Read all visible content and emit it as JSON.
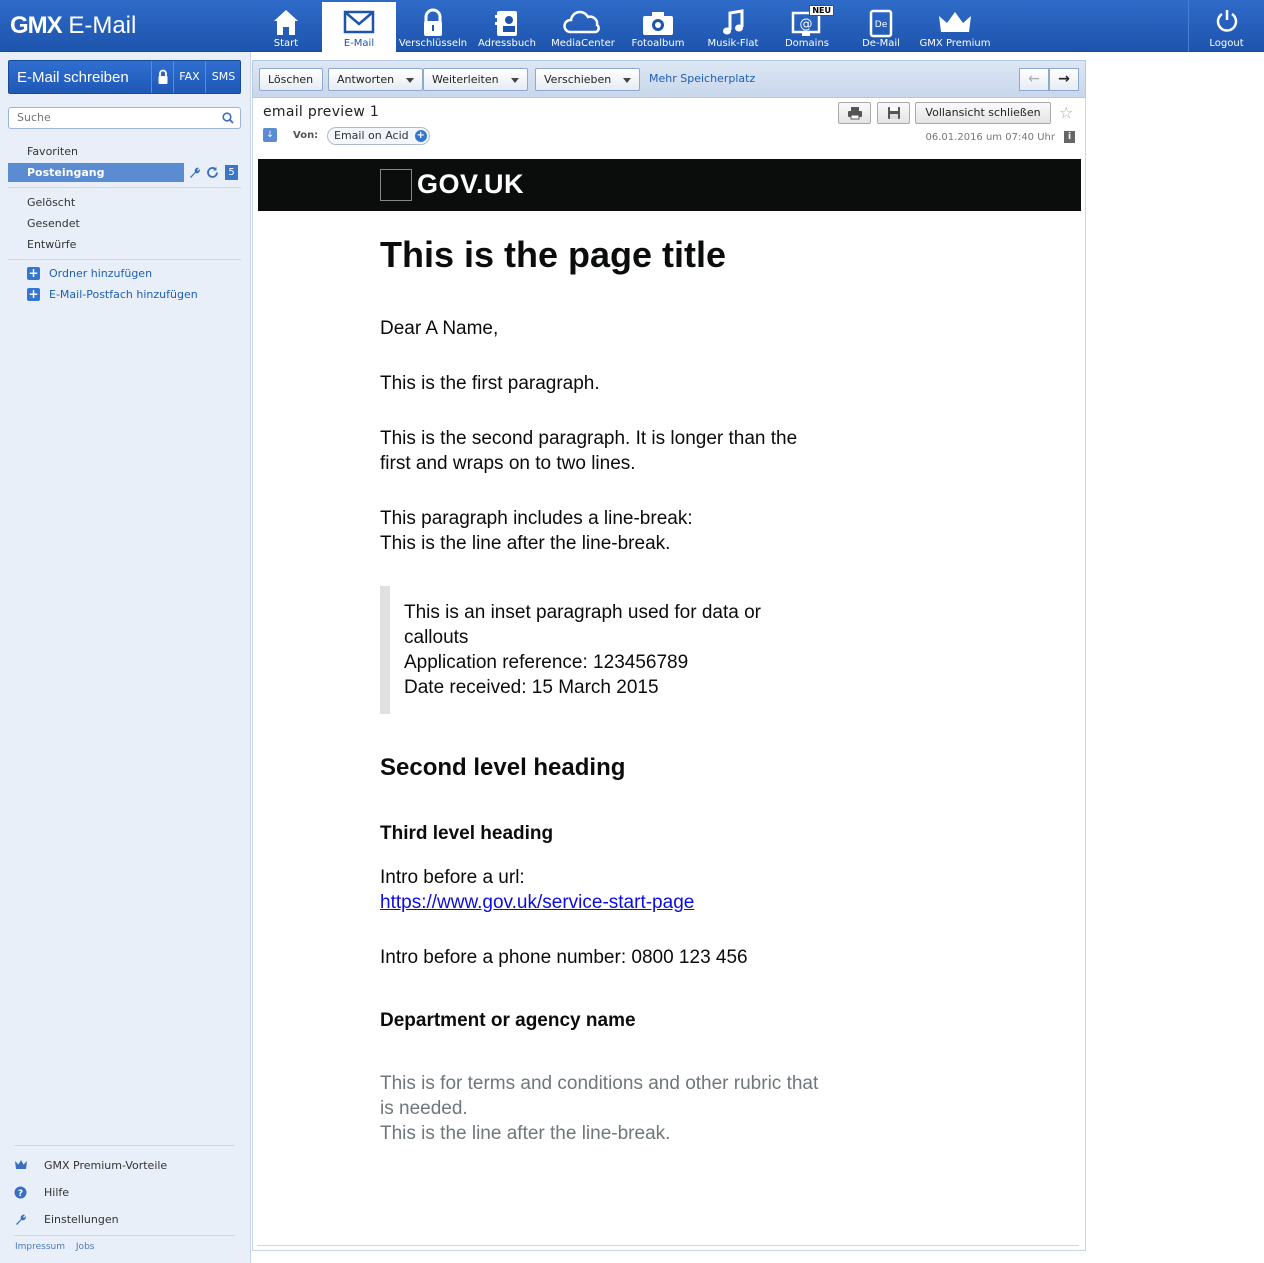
{
  "app": {
    "logo_brand": "GMX",
    "logo_product": "E-Mail"
  },
  "nav": [
    {
      "label": "Start",
      "icon": "home-icon"
    },
    {
      "label": "E-Mail",
      "icon": "envelope-icon",
      "active": true
    },
    {
      "label": "Verschlüsseln",
      "icon": "lock-icon"
    },
    {
      "label": "Adressbuch",
      "icon": "address-book-icon"
    },
    {
      "label": "MediaCenter",
      "icon": "cloud-icon"
    },
    {
      "label": "Fotoalbum",
      "icon": "camera-icon"
    },
    {
      "label": "Musik-Flat",
      "icon": "music-note-icon"
    },
    {
      "label": "Domains",
      "icon": "domain-icon",
      "badge": "NEU"
    },
    {
      "label": "De-Mail",
      "icon": "de-mail-icon"
    },
    {
      "label": "GMX Premium",
      "icon": "crown-icon"
    }
  ],
  "logout": {
    "label": "Logout",
    "icon": "power-icon"
  },
  "sidebar": {
    "compose": {
      "label": "E-Mail schreiben",
      "fax": "FAX",
      "sms": "SMS"
    },
    "search": {
      "placeholder": "Suche"
    },
    "folders": {
      "favoriten": "Favoriten",
      "posteingang": "Posteingang",
      "posteingang_count": "5",
      "geloescht": "Gelöscht",
      "gesendet": "Gesendet",
      "entwuerfe": "Entwürfe"
    },
    "add_folder": "Ordner hinzufügen",
    "add_mailbox": "E-Mail-Postfach hinzufügen",
    "bottom": {
      "premium": "GMX Premium-Vorteile",
      "help": "Hilfe",
      "settings": "Einstellungen"
    },
    "footer": {
      "impressum": "Impressum",
      "jobs": "Jobs"
    }
  },
  "toolbar": {
    "delete": "Löschen",
    "reply": "Antworten",
    "forward": "Weiterleiten",
    "move": "Verschieben",
    "more_space": "Mehr Speicherplatz"
  },
  "message": {
    "subject": "email preview 1",
    "from_label": "Von:",
    "from": "Email on Acid",
    "date": "06.01.2016 um 07:40 Uhr",
    "close_fullview": "Vollansicht schließen"
  },
  "email": {
    "header": "GOV.UK",
    "title": "This is the page title",
    "greeting": "Dear A Name,",
    "p1": "This is the first paragraph.",
    "p2_line1": "This is the second paragraph. It is longer than the",
    "p2_line2": "first and wraps on to two lines.",
    "p3_line1": "This paragraph includes a line-break:",
    "p3_line2": "This is the line after the line-break.",
    "inset_line1": "This is an inset paragraph used for data or",
    "inset_line2": "callouts",
    "inset_ref": "Application reference: 123456789",
    "inset_date": "Date received: 15 March 2015",
    "h2": "Second level heading",
    "h3": "Third level heading",
    "url_intro": "Intro before a url:",
    "url": "https://www.gov.uk/service-start-page",
    "phone": "Intro before a phone number: 0800 123 456",
    "dept": "Department or agency name",
    "terms_line1": "This is for terms and conditions and other rubric that",
    "terms_line2": "is needed.",
    "terms_line3": "This is the line after the line-break."
  }
}
